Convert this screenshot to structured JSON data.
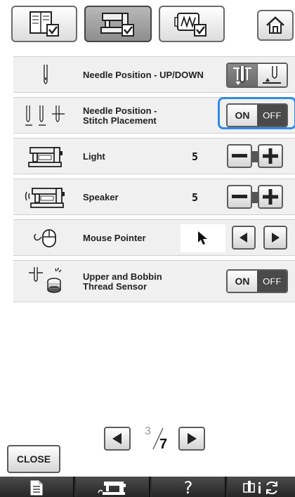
{
  "rows": [
    {
      "label": "Needle Position - UP/DOWN"
    },
    {
      "label": "Needle Position -\nStitch Placement",
      "toggle": {
        "on": "ON",
        "off": "OFF"
      }
    },
    {
      "label": "Light",
      "value": "5"
    },
    {
      "label": "Speaker",
      "value": "5"
    },
    {
      "label": "Mouse Pointer"
    },
    {
      "label": "Upper and Bobbin\nThread Sensor",
      "toggle": {
        "on": "ON",
        "off": "OFF"
      }
    }
  ],
  "pager": {
    "current": "3",
    "total": "7"
  },
  "close_label": "CLOSE",
  "bottom_help": "?",
  "colors": {
    "accent": "#2e8ce8",
    "row_bg": "#f0f0f0",
    "bottom_bar": "#303030"
  }
}
